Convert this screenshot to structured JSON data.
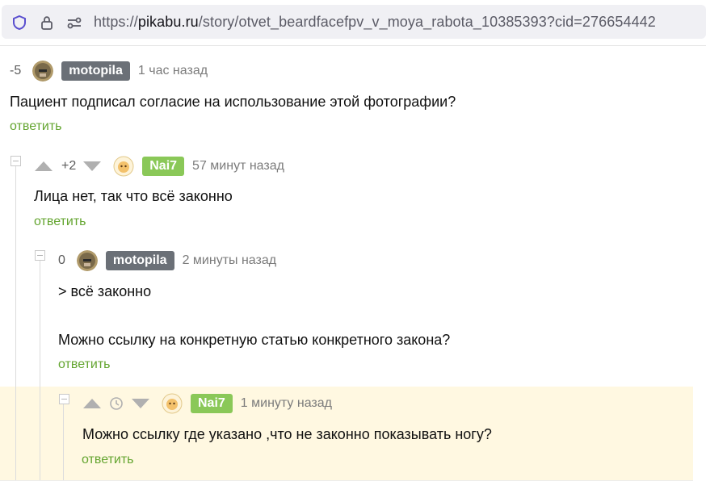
{
  "browser": {
    "url_scheme": "https://",
    "url_host": "pikabu.ru",
    "url_path": "/story/otvet_beardfacefpv_v_moya_rabota_10385393?cid=276654442"
  },
  "comments": [
    {
      "rating": "-5",
      "author": "motopila",
      "time": "1 час назад",
      "text": "Пациент подписал согласие на использование этой фотографии?",
      "reply": "ответить"
    },
    {
      "rating": "+2",
      "author": "Nai7",
      "time": "57 минут назад",
      "text": "Лица нет, так что всё законно",
      "reply": "ответить"
    },
    {
      "rating": "0",
      "author": "motopila",
      "time": "2 минуты назад",
      "text_line1": "> всё законно",
      "text_line2": "Можно ссылку на конкретную статью конкретного закона?",
      "reply": "ответить"
    },
    {
      "author": "Nai7",
      "time": "1 минуту назад",
      "text": "Можно ссылку где указано ,что не законно показывать ногу?",
      "reply": "ответить"
    }
  ],
  "colors": {
    "accent_green": "#8ac858",
    "reply_green": "#64a530",
    "badge_gray": "#6b7077",
    "highlight_bg": "#fff8e1"
  }
}
